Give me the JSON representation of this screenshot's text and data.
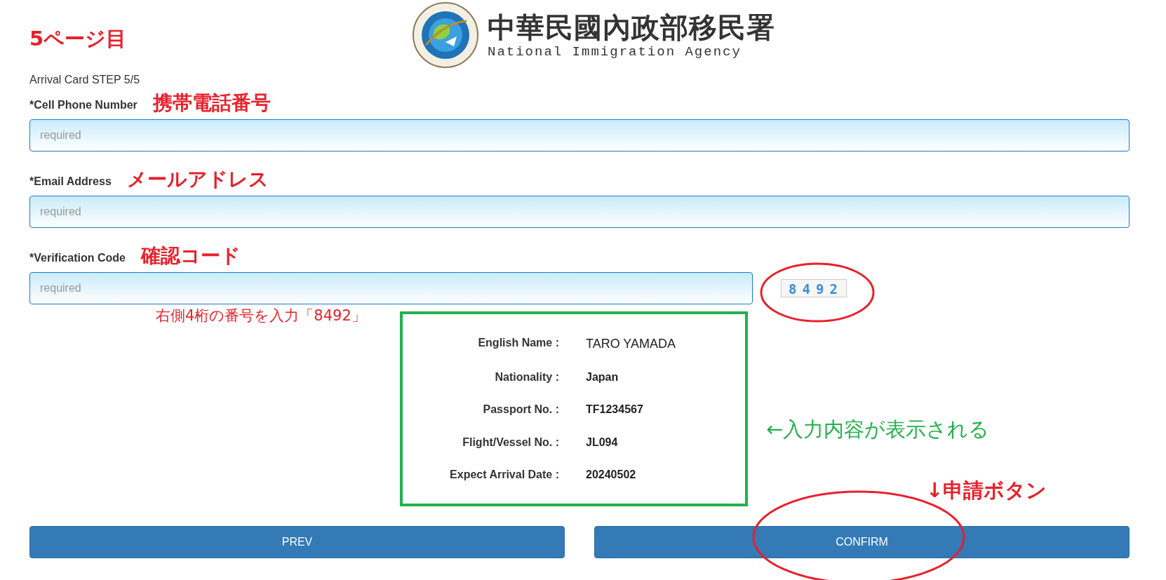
{
  "page_note": "5ページ目",
  "logo": {
    "title_zh": "中華民國內政部移民署",
    "title_en": "National Immigration Agency"
  },
  "step": "Arrival Card STEP 5/5",
  "fields": [
    {
      "label": "*Cell Phone Number",
      "note": "携帯電話番号",
      "placeholder": "required"
    },
    {
      "label": "*Email Address",
      "note": "メールアドレス",
      "placeholder": "required"
    }
  ],
  "verification": {
    "label": "*Verification Code",
    "note": "確認コード",
    "placeholder": "required",
    "hint": "右側4桁の番号を入力「8492」",
    "captcha": "8492"
  },
  "summary": {
    "note": "←入力内容が表示される",
    "rows": [
      {
        "label": "English Name :",
        "value": "TARO YAMADA",
        "bold": false
      },
      {
        "label": "Nationality :",
        "value": "Japan",
        "bold": true
      },
      {
        "label": "Passport No. :",
        "value": "TF1234567",
        "bold": true
      },
      {
        "label": "Flight/Vessel No. :",
        "value": "JL094",
        "bold": true
      },
      {
        "label": "Expect Arrival Date :",
        "value": "20240502",
        "bold": true
      }
    ]
  },
  "buttons": [
    {
      "label": "PREV"
    },
    {
      "label": "CONFIRM",
      "note": "↓申請ボタン"
    }
  ]
}
